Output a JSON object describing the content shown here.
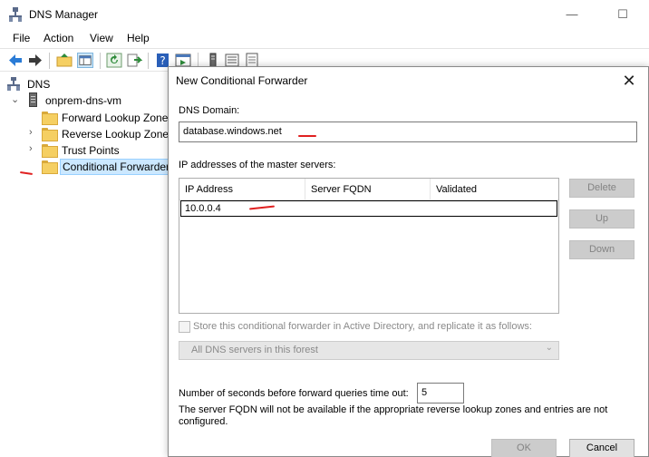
{
  "window": {
    "title": "DNS Manager",
    "minimize_glyph": "—",
    "maximize_glyph": "☐"
  },
  "menu": {
    "items": [
      "File",
      "Action",
      "View",
      "Help"
    ]
  },
  "toolbar": {
    "icons": [
      "back-arrow-icon",
      "forward-arrow-icon",
      "folder-up-icon",
      "console-tree-icon",
      "refresh-icon",
      "export-list-icon",
      "help-icon",
      "properties-icon",
      "server-icon",
      "zone-icon",
      "record-icon"
    ]
  },
  "tree": {
    "root": "DNS",
    "server": "onprem-dns-vm",
    "items": [
      "Forward Lookup Zones",
      "Reverse Lookup Zones",
      "Trust Points",
      "Conditional Forwarders"
    ]
  },
  "dialog": {
    "title": "New Conditional Forwarder",
    "close_glyph": "✕",
    "dns_domain_label": "DNS Domain:",
    "dns_domain_value": "database.windows.net",
    "ip_section_label": "IP addresses of the master servers:",
    "columns": [
      "IP Address",
      "Server FQDN",
      "Validated"
    ],
    "ip_value": "10.0.0.4",
    "buttons": {
      "delete": "Delete",
      "up": "Up",
      "down": "Down",
      "ok": "OK",
      "cancel": "Cancel"
    },
    "store_checkbox_label": "Store this conditional forwarder in Active Directory, and replicate it as follows:",
    "store_checked": false,
    "replication_scope": "All DNS servers in this forest",
    "timeout_label": "Number of seconds before forward queries time out:",
    "timeout_value": "5",
    "fqdn_note": "The server FQDN will not be available if the appropriate reverse lookup zones and entries are not configured."
  },
  "colors": {
    "selection": "#cce8ff",
    "annotation": "#e02020",
    "folder": "#f5cf62"
  }
}
